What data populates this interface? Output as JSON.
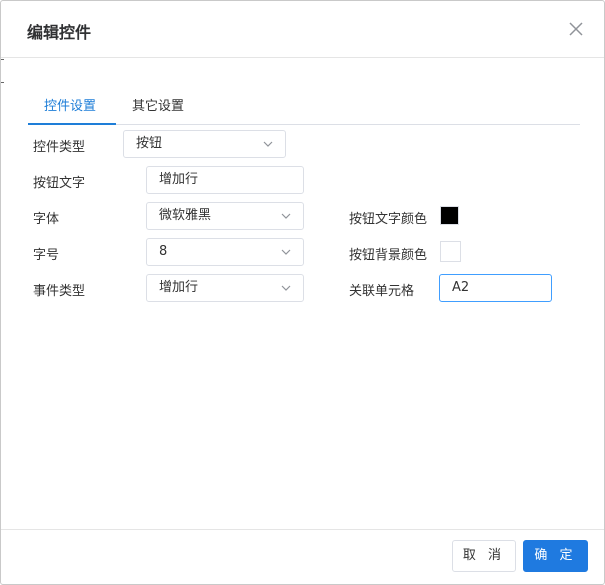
{
  "dialog": {
    "title": "编辑控件"
  },
  "tabs": [
    {
      "label": "控件设置",
      "active": true
    },
    {
      "label": "其它设置",
      "active": false
    }
  ],
  "form": {
    "control_type": {
      "label": "控件类型",
      "value": "按钮"
    },
    "button_text": {
      "label": "按钮文字",
      "value": "增加行"
    },
    "font": {
      "label": "字体",
      "value": "微软雅黑"
    },
    "font_size": {
      "label": "字号",
      "value": "8"
    },
    "event_type": {
      "label": "事件类型",
      "value": "增加行"
    },
    "text_color": {
      "label": "按钮文字颜色",
      "color": "#000000"
    },
    "bg_color": {
      "label": "按钮背景颜色",
      "color": "#ffffff"
    },
    "linked_cell": {
      "label": "关联单元格",
      "value": "A2"
    }
  },
  "footer": {
    "cancel_label": "取 消",
    "ok_label": "确 定"
  },
  "colors": {
    "accent": "#1e7ed8",
    "primary_button": "#1f7ae0",
    "focus_border": "#409eff"
  },
  "icons": {
    "close": "close-icon",
    "dropdown": "chevron-down-icon"
  }
}
